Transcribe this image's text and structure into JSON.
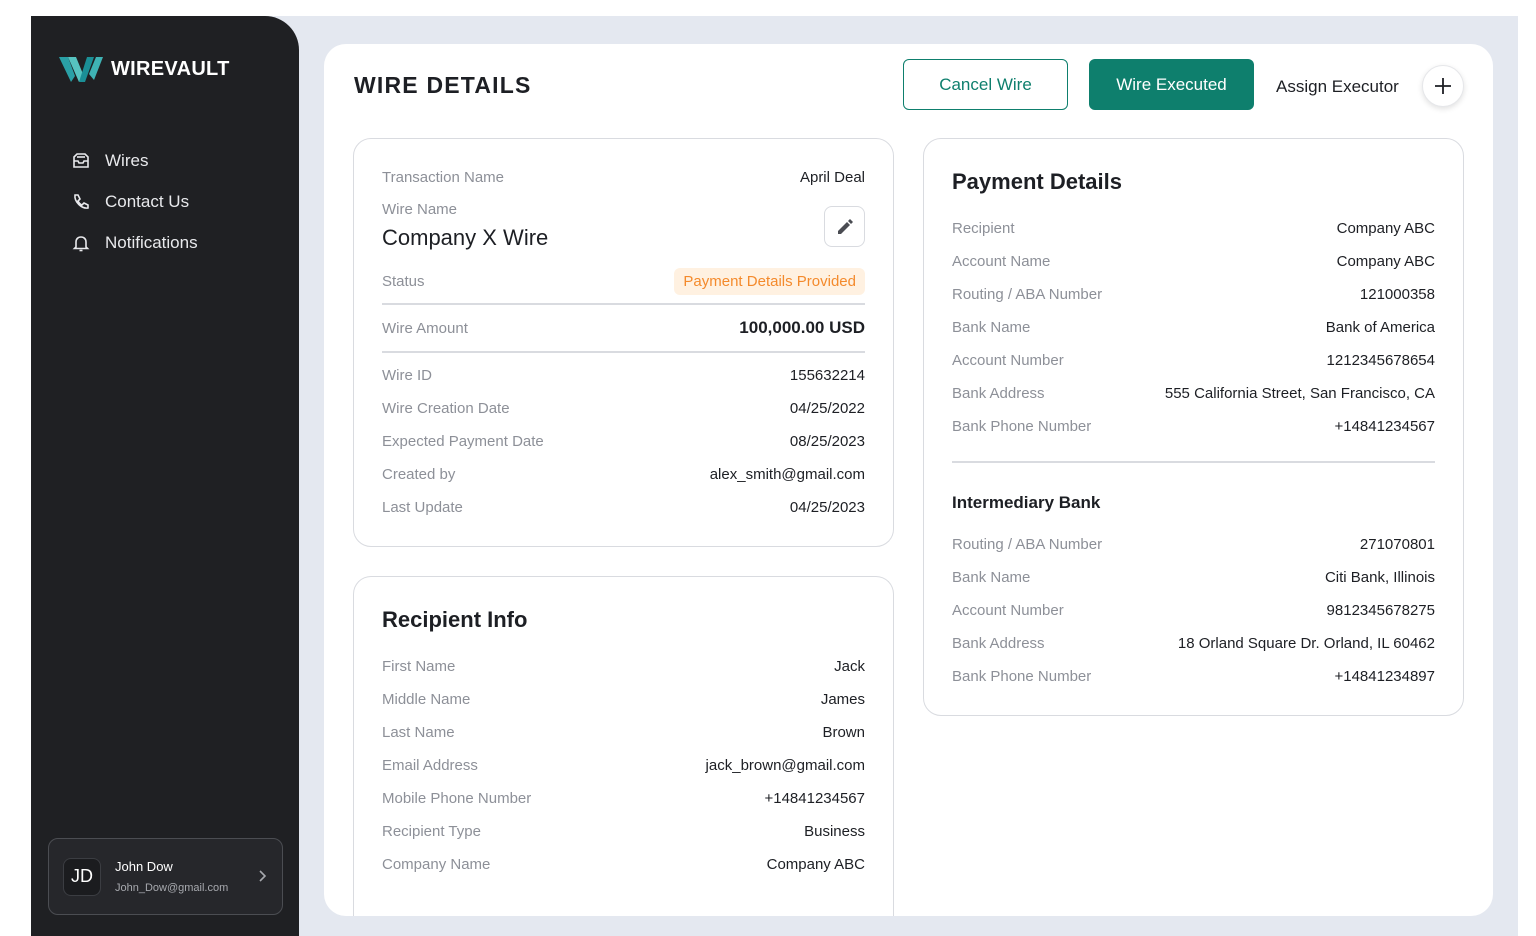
{
  "app": {
    "brand": "WIREVAULT"
  },
  "sidebar": {
    "items": [
      {
        "label": "Wires",
        "icon": "inbox-icon"
      },
      {
        "label": "Contact Us",
        "icon": "phone-icon"
      },
      {
        "label": "Notifications",
        "icon": "bell-icon"
      }
    ],
    "user": {
      "initials": "JD",
      "name": "John Dow",
      "email": "John_Dow@gmail.com"
    }
  },
  "header": {
    "title": "WIRE DETAILS",
    "cancel_label": "Cancel Wire",
    "executed_label": "Wire Executed",
    "assign_label": "Assign Executor"
  },
  "wire": {
    "transaction_label": "Transaction Name",
    "transaction_value": "April Deal",
    "wire_name_label": "Wire Name",
    "wire_name_value": "Company X Wire",
    "status_label": "Status",
    "status_value": "Payment Details Provided",
    "amount_label": "Wire Amount",
    "amount_value": "100,000.00 USD",
    "fields": [
      {
        "label": "Wire ID",
        "value": "155632214"
      },
      {
        "label": "Wire Creation Date",
        "value": "04/25/2022"
      },
      {
        "label": "Expected Payment Date",
        "value": "08/25/2023"
      },
      {
        "label": "Created by",
        "value": "alex_smith@gmail.com"
      },
      {
        "label": "Last Update",
        "value": "04/25/2023"
      }
    ]
  },
  "recipient": {
    "title": "Recipient Info",
    "fields": [
      {
        "label": "First Name",
        "value": "Jack"
      },
      {
        "label": "Middle Name",
        "value": "James"
      },
      {
        "label": "Last Name",
        "value": "Brown"
      },
      {
        "label": "Email Address",
        "value": "jack_brown@gmail.com"
      },
      {
        "label": "Mobile Phone Number",
        "value": "+14841234567"
      },
      {
        "label": "Recipient Type",
        "value": "Business"
      },
      {
        "label": "Company Name",
        "value": "Company ABC"
      }
    ]
  },
  "payment": {
    "title": "Payment Details",
    "fields": [
      {
        "label": "Recipient",
        "value": "Company ABC"
      },
      {
        "label": "Account Name",
        "value": "Company ABC"
      },
      {
        "label": "Routing / ABA Number",
        "value": "121000358"
      },
      {
        "label": "Bank Name",
        "value": "Bank of America"
      },
      {
        "label": "Account Number",
        "value": "1212345678654"
      },
      {
        "label": "Bank Address",
        "value": "555 California Street, San Francisco, CA"
      },
      {
        "label": "Bank Phone Number",
        "value": "+14841234567"
      }
    ],
    "intermediary_title": "Intermediary Bank",
    "intermediary": [
      {
        "label": "Routing / ABA Number",
        "value": "271070801"
      },
      {
        "label": "Bank Name",
        "value": "Citi Bank, Illinois"
      },
      {
        "label": "Account Number",
        "value": "9812345678275"
      },
      {
        "label": "Bank Address",
        "value": "18 Orland Square Dr. Orland, IL 60462"
      },
      {
        "label": "Bank Phone Number",
        "value": "+14841234897"
      }
    ]
  },
  "colors": {
    "accent": "#0e7f6d",
    "sidebar": "#1f2023",
    "badge_bg": "#fff1e1",
    "badge_text": "#f48a2c"
  }
}
